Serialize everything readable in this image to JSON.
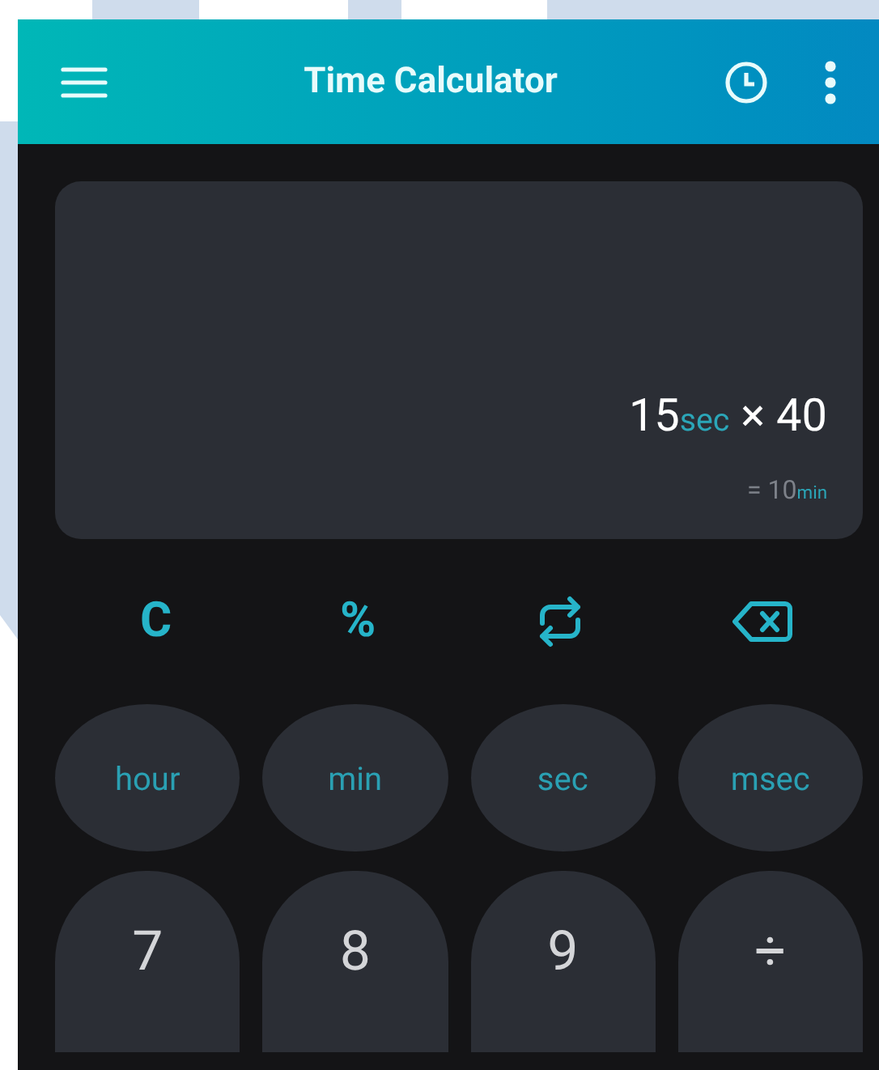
{
  "app_bar": {
    "title": "Time Calculator"
  },
  "display": {
    "expression": [
      {
        "text": "15",
        "kind": "number"
      },
      {
        "text": "sec",
        "kind": "unit"
      },
      {
        "text": " × 40",
        "kind": "number"
      }
    ],
    "result": [
      {
        "text": "= 10",
        "kind": "number"
      },
      {
        "text": "min",
        "kind": "unit"
      }
    ]
  },
  "function_keys": [
    {
      "kind": "text",
      "label": "C"
    },
    {
      "kind": "text",
      "label": "%"
    },
    {
      "kind": "swap"
    },
    {
      "kind": "backspace"
    }
  ],
  "unit_keys": [
    "hour",
    "min",
    "sec",
    "msec"
  ],
  "digit_keys": [
    "7",
    "8",
    "9",
    "÷"
  ]
}
